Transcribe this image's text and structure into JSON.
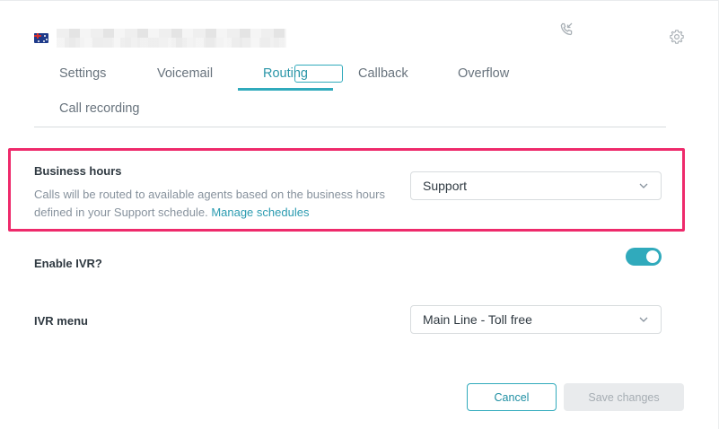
{
  "tabs": [
    {
      "label": "Settings"
    },
    {
      "label": "Voicemail"
    },
    {
      "label": "Routing"
    },
    {
      "label": "Callback"
    },
    {
      "label": "Overflow"
    },
    {
      "label": "Call recording"
    }
  ],
  "business_hours": {
    "label": "Business hours",
    "description": "Calls will be routed to available agents based on the business hours defined in your Support schedule.",
    "link": "Manage schedules",
    "selected": "Support"
  },
  "ivr": {
    "enable_label": "Enable IVR?",
    "enabled": true,
    "menu_label": "IVR menu",
    "menu_selected": "Main Line - Toll free"
  },
  "footer": {
    "cancel_label": "Cancel",
    "save_label": "Save changes"
  },
  "colors": {
    "accent": "#30aabc",
    "highlight": "#ee2a6b"
  }
}
